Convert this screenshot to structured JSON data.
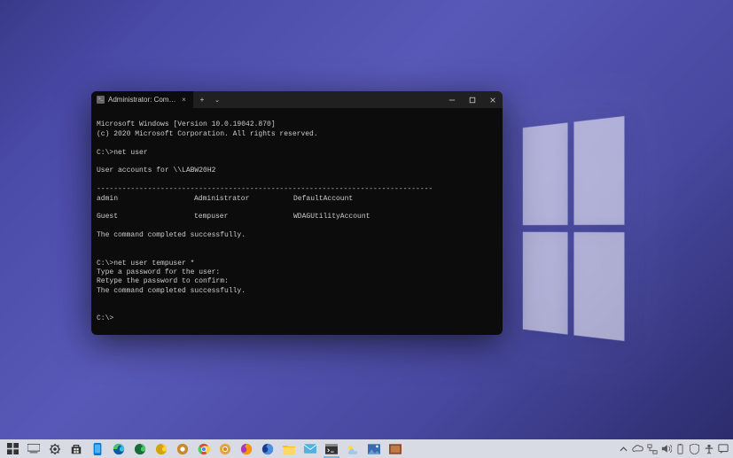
{
  "tab": {
    "title": "Administrator: Command Prompt",
    "close_glyph": "×",
    "newtab_glyph": "+",
    "dropdown_glyph": "⌄"
  },
  "winctrl": {
    "min": "—",
    "max": "▢",
    "close": "✕"
  },
  "term": {
    "l1": "Microsoft Windows [Version 10.0.19042.870]",
    "l2": "(c) 2020 Microsoft Corporation. All rights reserved.",
    "blank": "",
    "p1": "C:\\>net user",
    "l3": "User accounts for \\\\LABW20H2",
    "hr": "-------------------------------------------------------------------------------",
    "r1c0": "admin",
    "r1c1": "Administrator",
    "r1c2": "DefaultAccount",
    "r2c0": "Guest",
    "r2c1": "tempuser",
    "r2c2": "WDAGUtilityAccount",
    "l4": "The command completed successfully.",
    "p2": "C:\\>net user tempuser *",
    "l5": "Type a password for the user:",
    "l6": "Retype the password to confirm:",
    "l7": "The command completed successfully.",
    "p3": "C:\\>"
  },
  "taskbar": {
    "items": [
      {
        "name": "start-button"
      },
      {
        "name": "task-view"
      },
      {
        "name": "settings"
      },
      {
        "name": "microsoft-store"
      },
      {
        "name": "your-phone"
      },
      {
        "name": "edge"
      },
      {
        "name": "edge-dev"
      },
      {
        "name": "edge-canary"
      },
      {
        "name": "file-explorer-alt"
      },
      {
        "name": "chrome"
      },
      {
        "name": "chrome-canary"
      },
      {
        "name": "firefox"
      },
      {
        "name": "firefox-dev"
      },
      {
        "name": "file-explorer"
      },
      {
        "name": "mail"
      },
      {
        "name": "terminal",
        "active": true
      },
      {
        "name": "weather"
      },
      {
        "name": "photos"
      },
      {
        "name": "app-misc"
      }
    ]
  },
  "tray": {
    "items": [
      {
        "name": "chevron-up-icon",
        "glyph": "˄"
      },
      {
        "name": "onedrive-icon",
        "glyph": "☁"
      },
      {
        "name": "network-icon",
        "glyph": "🖧"
      },
      {
        "name": "volume-icon",
        "glyph": "🔊"
      },
      {
        "name": "battery-icon",
        "glyph": ""
      },
      {
        "name": "security-icon",
        "glyph": ""
      },
      {
        "name": "input-icon",
        "glyph": ""
      },
      {
        "name": "action-center-icon",
        "glyph": "💬"
      }
    ]
  }
}
